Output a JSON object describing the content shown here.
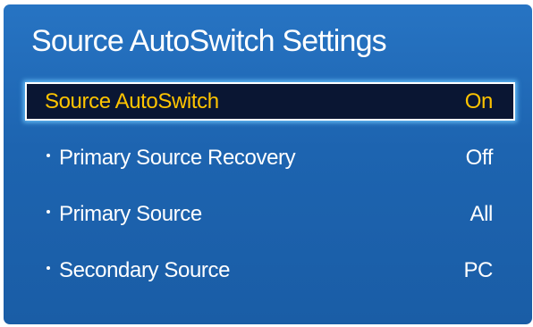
{
  "dialog": {
    "title": "Source AutoSwitch Settings"
  },
  "menu": {
    "items": [
      {
        "label": "Source AutoSwitch",
        "value": "On",
        "selected": true
      },
      {
        "label": "Primary Source Recovery",
        "value": "Off"
      },
      {
        "label": "Primary Source",
        "value": "All"
      },
      {
        "label": "Secondary Source",
        "value": "PC"
      }
    ]
  },
  "colors": {
    "panel_background": "#1f68b5",
    "highlight_background": "#0a1633",
    "highlight_text": "#ffc400",
    "text": "#ffffff"
  }
}
